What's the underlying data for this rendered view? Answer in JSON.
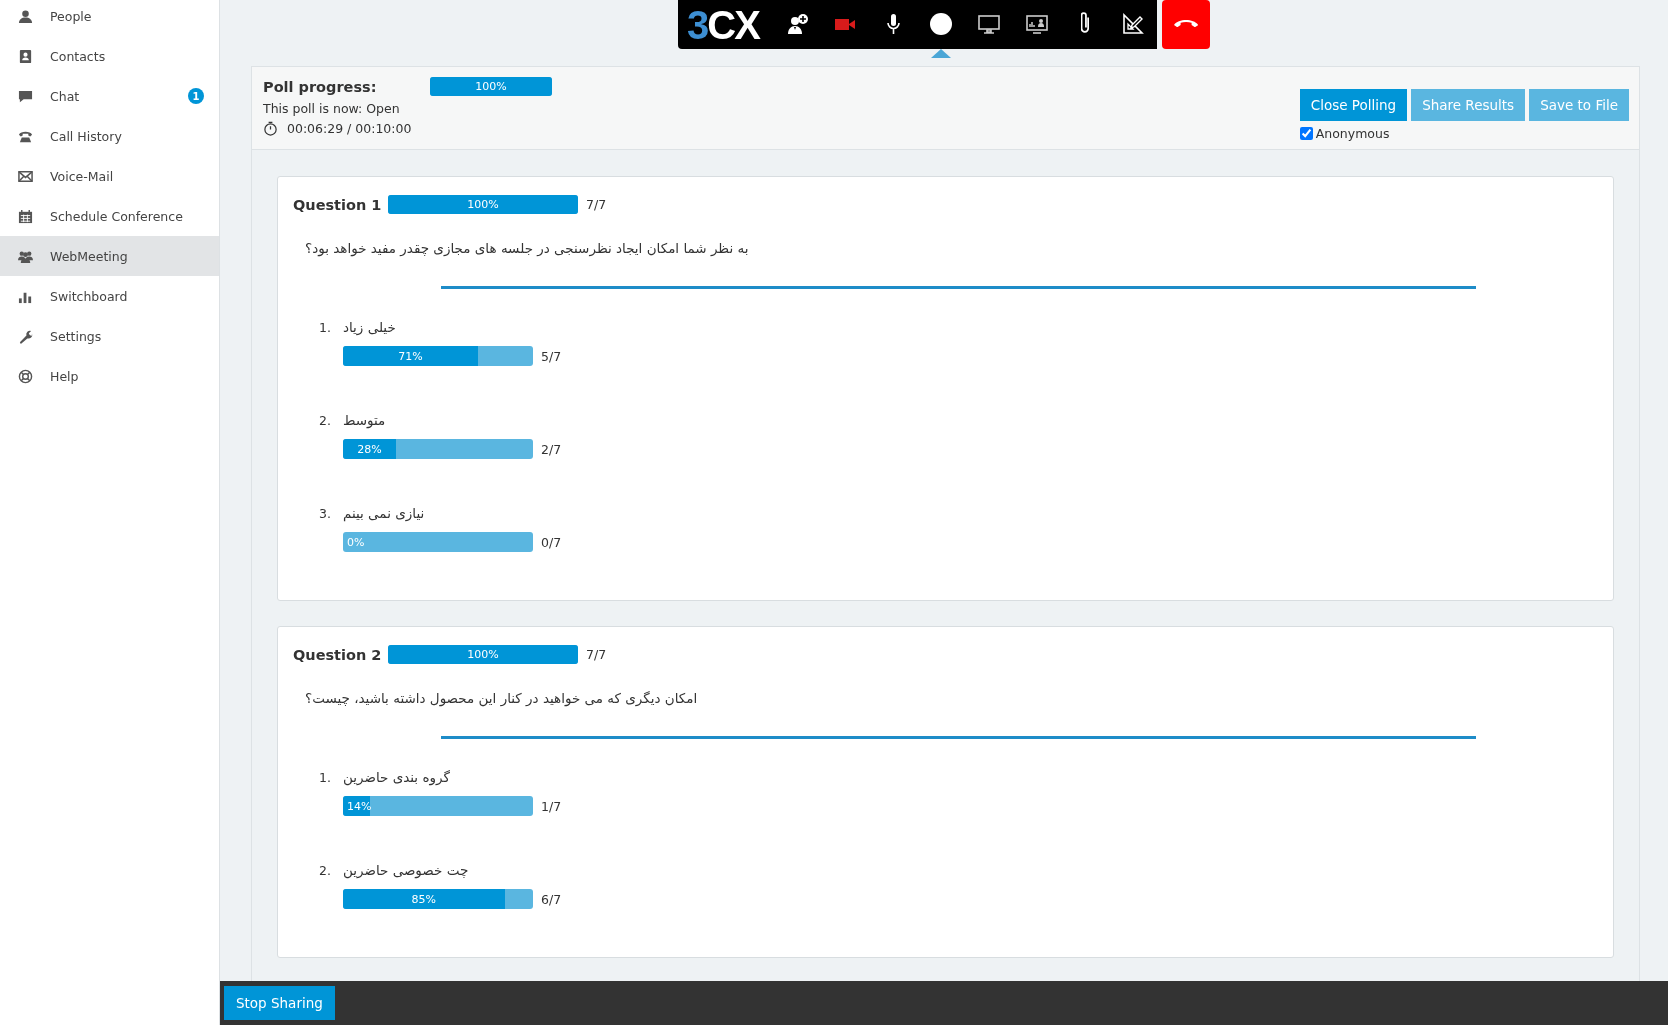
{
  "sidebar": {
    "items": [
      {
        "label": "People",
        "selected": false
      },
      {
        "label": "Contacts",
        "selected": false
      },
      {
        "label": "Chat",
        "selected": false,
        "badge": "1"
      },
      {
        "label": "Call History",
        "selected": false
      },
      {
        "label": "Voice-Mail",
        "selected": false
      },
      {
        "label": "Schedule Conference",
        "selected": false
      },
      {
        "label": "WebMeeting",
        "selected": true
      },
      {
        "label": "Switchboard",
        "selected": false
      },
      {
        "label": "Settings",
        "selected": false
      },
      {
        "label": "Help",
        "selected": false
      }
    ]
  },
  "toolbar": {
    "logo": "3CX",
    "tools": [
      {
        "kind": "add-participant",
        "selected": false
      },
      {
        "kind": "camera",
        "selected": false
      },
      {
        "kind": "microphone",
        "selected": false
      },
      {
        "kind": "record",
        "selected": true
      },
      {
        "kind": "screen",
        "selected": false
      },
      {
        "kind": "presentation",
        "selected": false
      },
      {
        "kind": "attachment",
        "selected": false
      },
      {
        "kind": "whiteboard",
        "selected": false
      },
      {
        "kind": "hang-up",
        "selected": false
      }
    ]
  },
  "poll": {
    "title": "Poll progress:",
    "level": 1,
    "percent": "100%",
    "status": "This poll is now: Open",
    "timer": "00:06:29 / 00:10:00",
    "buttons": [
      {
        "label": "Close Polling",
        "kind": "primary"
      },
      {
        "label": "Share Results",
        "kind": "secondary"
      },
      {
        "label": "Save to File",
        "kind": "secondary"
      }
    ],
    "anonymous": {
      "label": "Anonymous",
      "checked": true
    }
  },
  "questions": [
    {
      "title": "Question 1",
      "level": 1,
      "percent": "100%",
      "count": "7/7",
      "text": "به نظر شما امکان ایجاد نظرسنجی در جلسه های مجازی چقدر مفید خواهد بود؟",
      "options": [
        {
          "number": "1.",
          "text": "خیلی زیاد",
          "level": 0.71,
          "percent": "71%",
          "count": "5/7"
        },
        {
          "number": "2.",
          "text": "متوسط",
          "level": 0.28,
          "percent": "28%",
          "count": "2/7"
        },
        {
          "number": "3.",
          "text": "نیازی نمی بینم",
          "level": 0,
          "percent": "0%",
          "count": "0/7"
        }
      ]
    },
    {
      "title": "Question 2",
      "level": 1,
      "percent": "100%",
      "count": "7/7",
      "text": "امکان دیگری که می خواهید در کنار این محصول داشته باشید، چیست؟",
      "options": [
        {
          "number": "1.",
          "text": "گروه بندی حاضرین",
          "level": 0.14,
          "percent": "14%",
          "count": "1/7"
        },
        {
          "number": "2.",
          "text": "چت خصوصی حاضرین",
          "level": 0.85,
          "percent": "85%",
          "count": "6/7"
        }
      ]
    }
  ],
  "bottom_bar": {
    "button": "Stop Sharing"
  }
}
